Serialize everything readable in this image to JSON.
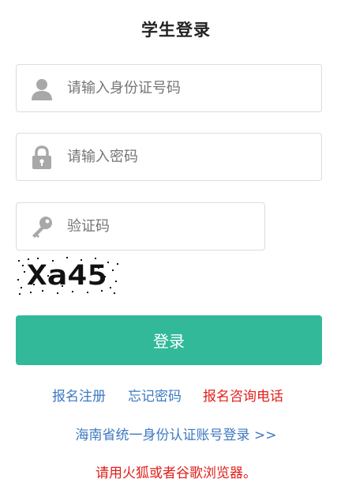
{
  "title": "学生登录",
  "fields": {
    "id_placeholder": "请输入身份证号码",
    "password_placeholder": "请输入密码",
    "captcha_placeholder": "验证码"
  },
  "captcha": {
    "code": "Xa45"
  },
  "login_label": "登录",
  "links": {
    "register": "报名注册",
    "forgot": "忘记密码",
    "hotline": "报名咨询电话"
  },
  "unified_login": "海南省统一身份认证账号登录 >>",
  "browser_note": "请用火狐或者谷歌浏览器。",
  "colors": {
    "accent": "#31b99a",
    "link": "#3d78c2",
    "warning": "#e0201b",
    "icon": "#a8a8a8"
  },
  "icons": {
    "id": "user-icon",
    "password": "lock-icon",
    "captcha": "key-icon"
  }
}
